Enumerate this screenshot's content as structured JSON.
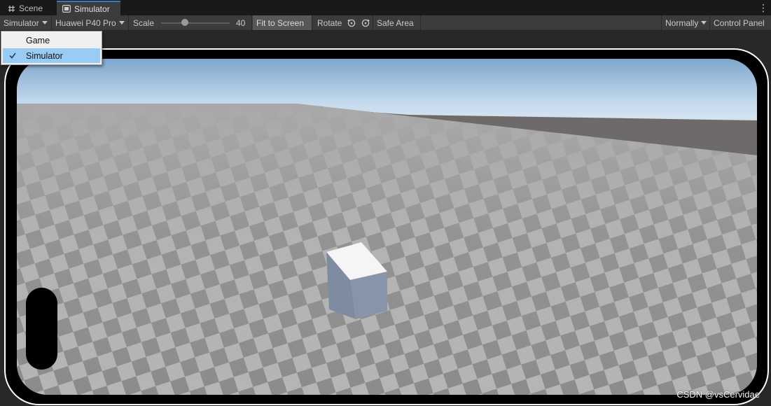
{
  "tabs": [
    {
      "label": "Scene",
      "icon": "hash-icon"
    },
    {
      "label": "Simulator",
      "icon": "device-icon"
    }
  ],
  "toolbar": {
    "mode_dropdown": "Simulator",
    "device_dropdown": "Huawei P40 Pro",
    "scale_label": "Scale",
    "scale_value": "40",
    "fit_to_screen": "Fit to Screen",
    "rotate_label": "Rotate",
    "safe_area": "Safe Area",
    "orientation_dropdown": "Normally",
    "control_panel": "Control Panel"
  },
  "menu": {
    "items": [
      {
        "label": "Game",
        "checked": false
      },
      {
        "label": "Simulator",
        "checked": true
      }
    ]
  },
  "watermark": "CSDN @vsCervidae",
  "colors": {
    "tab_accent": "#3a79bb",
    "menu_highlight": "#99ccf5",
    "cube_top": "#f7f7f7",
    "cube_side": "#8a97ad"
  }
}
